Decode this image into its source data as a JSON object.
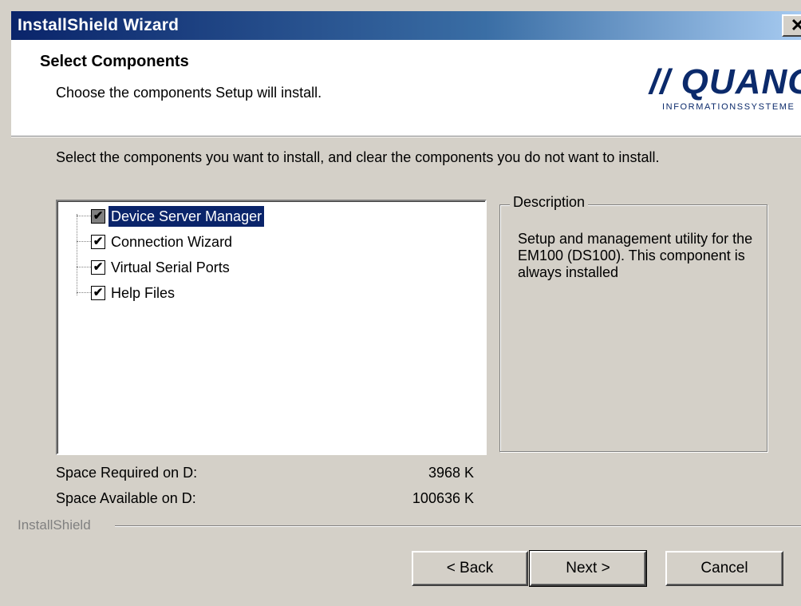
{
  "window": {
    "title": "InstallShield Wizard",
    "close_glyph": "✕"
  },
  "header": {
    "title": "Select Components",
    "subtitle": "Choose the components Setup will install.",
    "logo_main": "// QUANCOM",
    "logo_sub": "INFORMATIONSSYSTEME"
  },
  "instructions": "Select the components you want to install, and clear the components you do not want to install.",
  "components": [
    {
      "label": "Device Server Manager",
      "checked": true,
      "grayed": true,
      "selected": true
    },
    {
      "label": "Connection Wizard",
      "checked": true,
      "grayed": false,
      "selected": false
    },
    {
      "label": "Virtual Serial Ports",
      "checked": true,
      "grayed": false,
      "selected": false
    },
    {
      "label": "Help Files",
      "checked": true,
      "grayed": false,
      "selected": false
    }
  ],
  "description": {
    "legend": "Description",
    "text": "Setup and management utility for the EM100 (DS100). This component is always installed"
  },
  "space": {
    "required_label": "Space Required on  D:",
    "required_value": "3968 K",
    "available_label": "Space Available on  D:",
    "available_value": "100636 K"
  },
  "brand": "InstallShield",
  "buttons": {
    "back": "< Back",
    "next": "Next >",
    "cancel": "Cancel"
  },
  "check_glyph": "✔"
}
